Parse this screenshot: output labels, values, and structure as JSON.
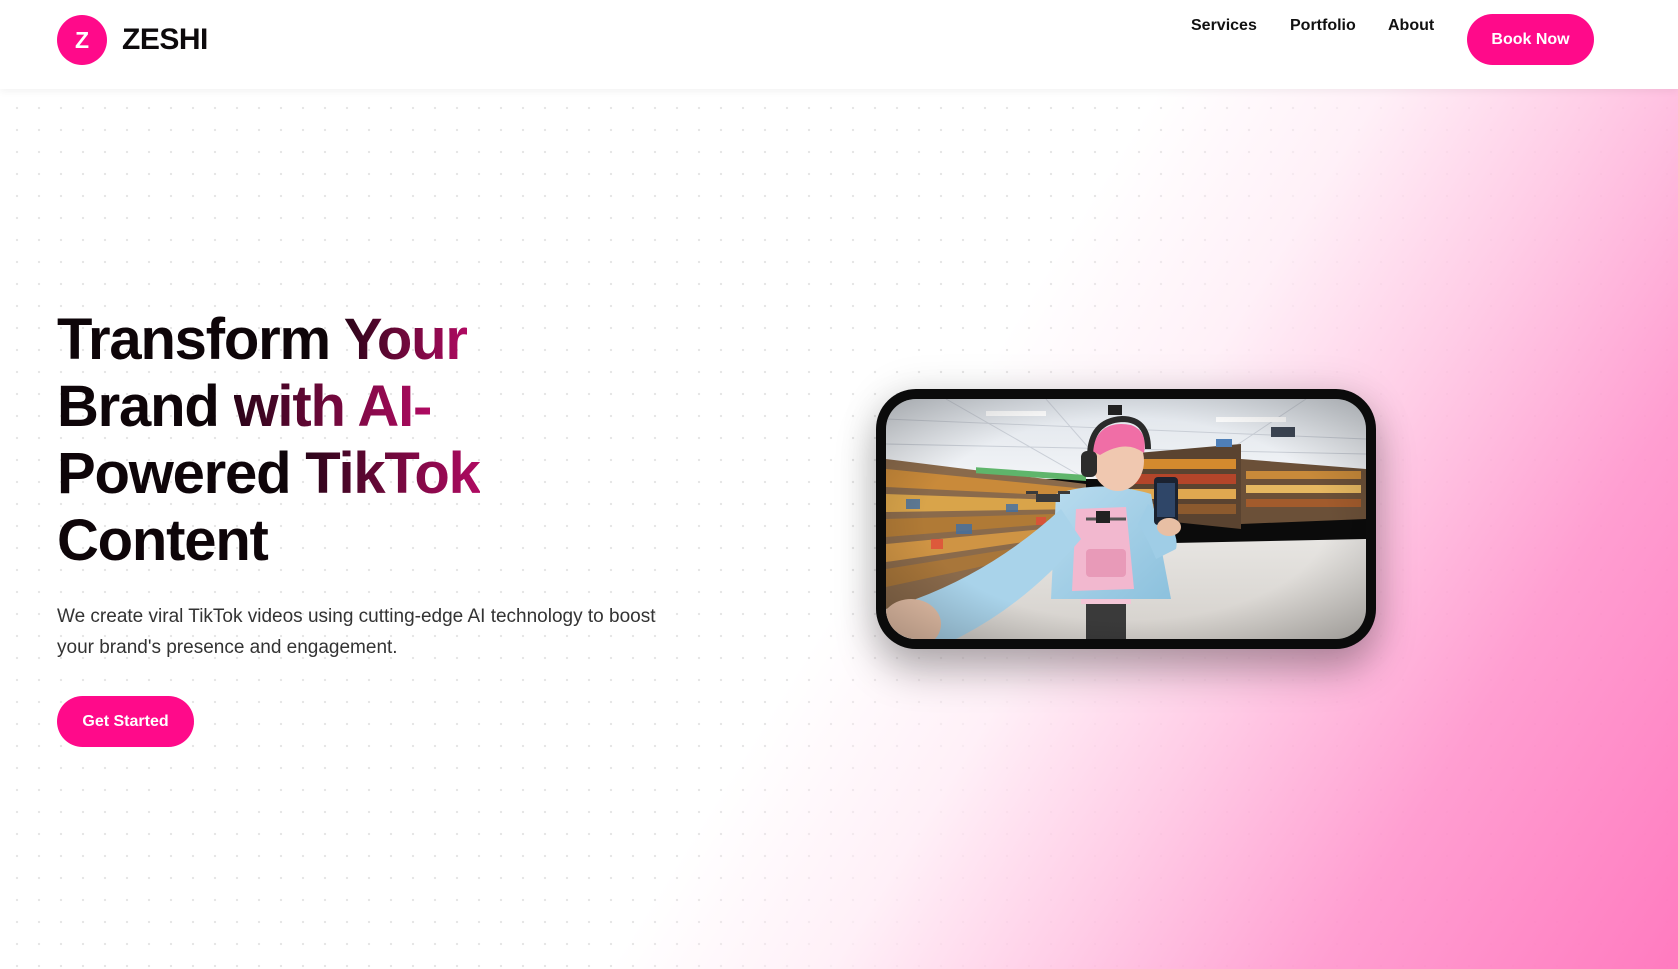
{
  "brand": {
    "logo_letter": "Z",
    "name": "ZESHI",
    "accent_color": "#ff0a8a"
  },
  "nav": {
    "items": [
      {
        "label": "Services"
      },
      {
        "label": "Portfolio"
      },
      {
        "label": "About"
      }
    ],
    "book_label": "Book Now"
  },
  "hero": {
    "title_parts": [
      "Transform ",
      "Your",
      "Brand ",
      "with AI-",
      "Powered ",
      "TikTok",
      "Content"
    ],
    "subtitle": "We create viral TikTok videos using cutting-edge AI technology to boost your brand's presence and engagement.",
    "cta_label": "Get Started"
  },
  "media": {
    "icon": "video-thumbnail",
    "subject": "person with pink hair and headphones filming selfie video in supermarket aisle"
  }
}
